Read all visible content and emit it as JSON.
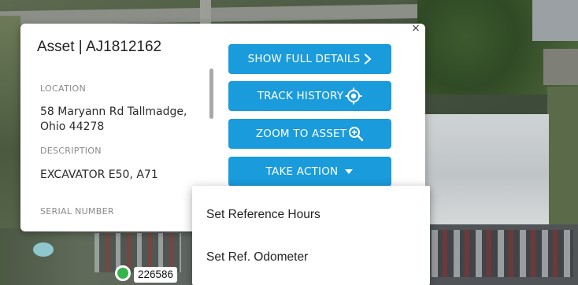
{
  "popup": {
    "close_glyph": "×",
    "title": "Asset | AJ1812162",
    "location_label": "LOCATION",
    "location_line1": "58 Maryann Rd Tallmadge,",
    "location_line2": "Ohio 44278",
    "description_label": "DESCRIPTION",
    "description_value": "EXCAVATOR E50, A71",
    "serial_label": "SERIAL NUMBER"
  },
  "buttons": {
    "show_full_details": "SHOW FULL DETAILS",
    "track_history": "TRACK HISTORY",
    "zoom_to_asset": "ZOOM TO ASSET",
    "take_action": "TAKE ACTION"
  },
  "icons": {
    "show_full_details": "chevron-right-icon",
    "track_history": "crosshair-icon",
    "zoom_to_asset": "zoom-in-icon",
    "take_action": "caret-down-icon"
  },
  "action_menu": {
    "items": [
      "Set Reference Hours",
      "Set Ref. Odometer"
    ]
  },
  "marker": {
    "label": "226586",
    "status_color": "#34b34a"
  },
  "colors": {
    "button_blue": "#1a9bdc"
  }
}
